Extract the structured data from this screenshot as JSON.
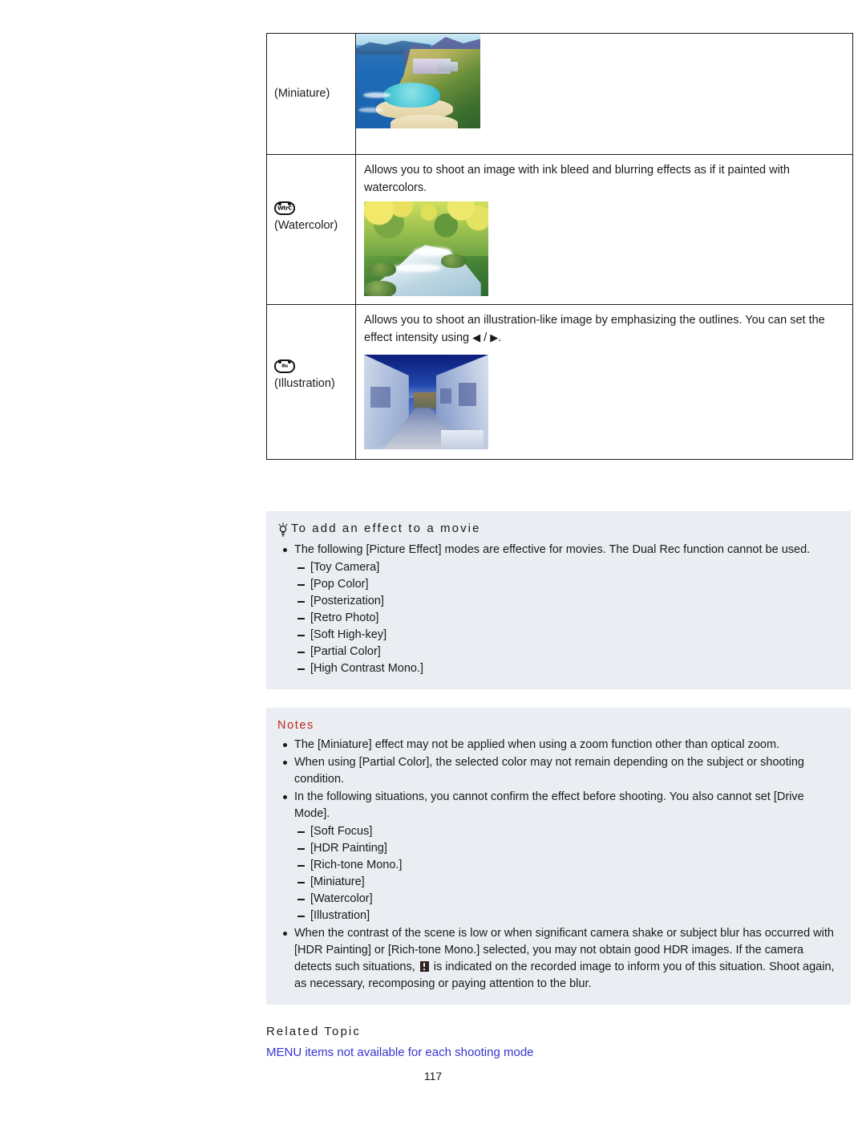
{
  "table": {
    "rows": [
      {
        "icon_text": "",
        "icon_lines": [],
        "label": "(Miniature)",
        "description": "",
        "image_alt": "miniature-effect-coastal-bay-sample"
      },
      {
        "icon_text": "WtrC",
        "icon_lines": [
          "WtrC"
        ],
        "label": "(Watercolor)",
        "description": "Allows you to shoot an image with ink bleed and blurring effects as if it painted with watercolors.",
        "image_alt": "watercolor-effect-forest-stream-sample"
      },
      {
        "icon_text": "Illu",
        "icon_lines": [
          "Illu",
          "ILLU"
        ],
        "label": "(Illustration)",
        "description_part1": "Allows you to shoot an illustration",
        "description_hyphen": "-",
        "description_part2": "like image by emphasizing the outlines. You can set the effect intensity using",
        "arrow_left": "◀",
        "arrow_sep": "/",
        "arrow_right": "▶",
        "description_end": ".",
        "image_alt": "illustration-effect-blue-alley-sample"
      }
    ]
  },
  "hint_panel": {
    "icon": "lightbulb-icon",
    "title": "To add an effect to a movie",
    "bullets": [
      "The following [Picture Effect] modes are effective for movies. The Dual Rec function cannot be used."
    ],
    "sub_items": [
      "[Toy Camera]",
      "[Pop Color]",
      "[Posterization]",
      "[Retro Photo]",
      "[Soft High-key]",
      "[Partial Color]",
      "[High Contrast Mono.]"
    ]
  },
  "notes_panel": {
    "title": "Notes",
    "title_color": "#c0271a",
    "bullets": [
      "The [Miniature] effect may not be applied when using a zoom function other than optical zoom.",
      "When using [Partial Color], the selected color may not remain depending on the subject or shooting condition.",
      "In the following situations, you cannot confirm the effect before shooting. You also cannot set [Drive Mode]."
    ],
    "sub_items": [
      "[Soft Focus]",
      "[HDR Painting]",
      "[Rich-tone Mono.]",
      "[Miniature]",
      "[Watercolor]",
      "[Illustration]"
    ],
    "last_bullet": {
      "part1": "When the contrast of the scene is low or when significant camera shake or subject blur has occurred with [HDR Painting] or [Rich-tone Mono.] selected, you may not obtain good HDR images. If the camera detects such situations,",
      "icon": "warning-exclamation-icon",
      "part2": "is indicated on the recorded image to inform you of this situation. Shoot again, as necessary, recomposing or paying attention to the blur."
    }
  },
  "footer": {
    "related_topic_heading": "Related Topic",
    "related_link": "MENU items not available for each shooting mode",
    "link_color": "#3734cf",
    "page_number": "117"
  }
}
